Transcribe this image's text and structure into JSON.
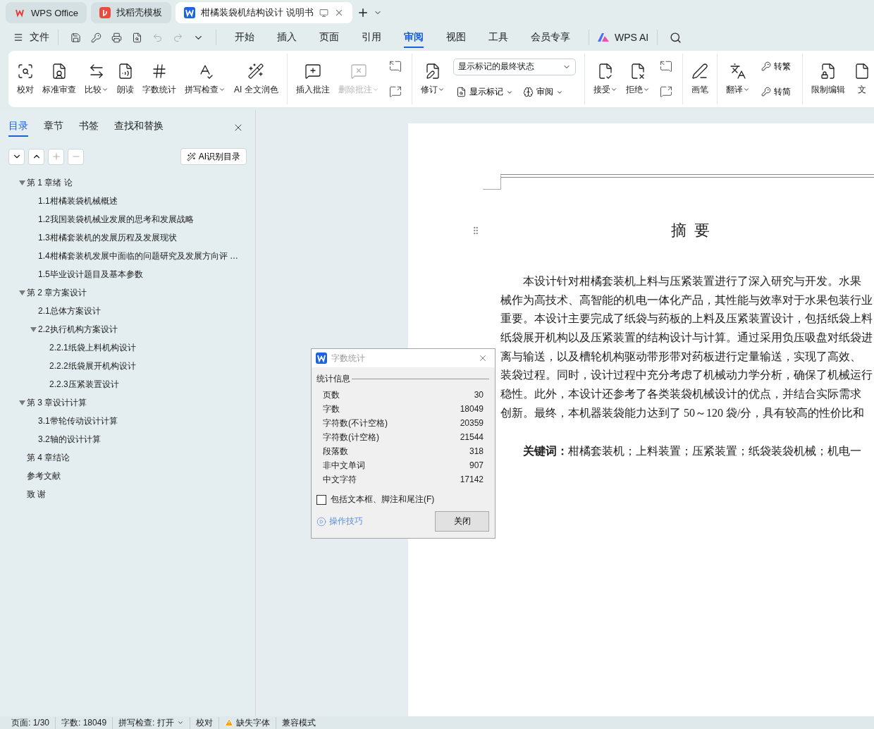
{
  "tabs": [
    {
      "label": "WPS Office",
      "kind": "home",
      "selected": false
    },
    {
      "label": "找稻壳模板",
      "kind": "template",
      "selected": false
    },
    {
      "label": "柑橘装袋机结构设计 说明书",
      "kind": "doc",
      "selected": true
    }
  ],
  "menu": {
    "file": "文件",
    "tabs": [
      {
        "label": "开始",
        "selected": false
      },
      {
        "label": "插入",
        "selected": false
      },
      {
        "label": "页面",
        "selected": false
      },
      {
        "label": "引用",
        "selected": false
      },
      {
        "label": "审阅",
        "selected": true
      },
      {
        "label": "视图",
        "selected": false
      },
      {
        "label": "工具",
        "selected": false
      },
      {
        "label": "会员专享",
        "selected": false
      }
    ],
    "ai": "WPS AI"
  },
  "ribbon": [
    {
      "items": [
        {
          "kind": "big",
          "label": "校对",
          "caret": false,
          "disabled": false
        },
        {
          "kind": "big",
          "label": "标准审查",
          "caret": false,
          "disabled": false
        },
        {
          "kind": "big",
          "label": "比较",
          "caret": true,
          "disabled": false
        },
        {
          "kind": "big",
          "label": "朗读",
          "caret": false,
          "disabled": false
        },
        {
          "kind": "big",
          "label": "字数统计",
          "caret": false,
          "disabled": false
        },
        {
          "kind": "big",
          "label": "拼写检查",
          "caret": true,
          "disabled": false
        },
        {
          "kind": "big",
          "label": "AI 全文润色",
          "caret": false,
          "disabled": false
        }
      ]
    },
    {
      "items": [
        {
          "kind": "big",
          "label": "插入批注",
          "caret": false,
          "disabled": false
        },
        {
          "kind": "big",
          "label": "删除批注",
          "caret": true,
          "disabled": true
        },
        {
          "kind": "icons"
        }
      ]
    },
    {
      "items": [
        {
          "kind": "big",
          "label": "修订",
          "caret": true,
          "disabled": false
        },
        {
          "kind": "panel",
          "select": "显示标记的最终状态",
          "buttons": [
            {
              "label": "显示标记"
            },
            {
              "label": "审阅"
            }
          ]
        }
      ]
    },
    {
      "items": [
        {
          "kind": "big",
          "label": "接受",
          "caret": true,
          "disabled": false
        },
        {
          "kind": "big",
          "label": "拒绝",
          "caret": true,
          "disabled": false
        },
        {
          "kind": "icons"
        }
      ]
    },
    {
      "items": [
        {
          "kind": "big",
          "label": "画笔",
          "caret": false,
          "disabled": false
        }
      ]
    },
    {
      "items": [
        {
          "kind": "big",
          "label": "翻译",
          "caret": true,
          "disabled": false
        },
        {
          "kind": "stack",
          "buttons": [
            {
              "label": "转繁"
            },
            {
              "label": "转简"
            }
          ]
        }
      ]
    },
    {
      "items": [
        {
          "kind": "big",
          "label": "限制编辑",
          "caret": false,
          "disabled": false
        },
        {
          "kind": "big",
          "label": "文",
          "caret": false,
          "disabled": false
        }
      ]
    }
  ],
  "sidebar": {
    "tabs": [
      {
        "label": "目录",
        "selected": true
      },
      {
        "label": "章节",
        "selected": false
      },
      {
        "label": "书签",
        "selected": false
      },
      {
        "label": "查找和替换",
        "selected": false
      }
    ],
    "toolbar": [
      {
        "kind": "down",
        "disabled": false
      },
      {
        "kind": "up",
        "disabled": false
      },
      {
        "kind": "plus",
        "disabled": true
      },
      {
        "kind": "minus",
        "disabled": true
      }
    ],
    "ai_button": "AI识别目录",
    "toc": [
      {
        "label": "第 1 章绪  论",
        "expanded": true,
        "children": [
          {
            "label": "1.1柑橘装袋机械概述"
          },
          {
            "label": "1.2我国装袋机械业发展的思考和发展战略"
          },
          {
            "label": "1.3柑橘套装机的发展历程及发展现状"
          },
          {
            "label": "1.4柑橘套装机发展中面临的问题研究及发展方向评 …"
          },
          {
            "label": "1.5毕业设计题目及基本参数"
          }
        ]
      },
      {
        "label": "第 2 章方案设计",
        "expanded": true,
        "children": [
          {
            "label": "2.1总体方案设计"
          },
          {
            "label": "2.2执行机构方案设计",
            "expanded": true,
            "children": [
              {
                "label": "2.2.1纸袋上料机构设计"
              },
              {
                "label": "2.2.2纸袋展开机构设计"
              },
              {
                "label": "2.2.3压紧装置设计"
              }
            ]
          }
        ]
      },
      {
        "label": "第 3 章设计计算",
        "expanded": true,
        "children": [
          {
            "label": "3.1带轮传动设计计算"
          },
          {
            "label": "3.2轴的设计计算"
          }
        ]
      },
      {
        "label": "第 4 章结论"
      },
      {
        "label": "参考文献"
      },
      {
        "label": "致  谢"
      }
    ]
  },
  "document": {
    "title": "摘  要",
    "lines": [
      "本设计针对柑橘套装机上料与压紧装置进行了深入研究与开发。水果",
      "械作为高技术、高智能的机电一体化产品，其性能与效率对于水果包装行业",
      "重要。本设计主要完成了纸袋与药板的上料及压紧装置设计，包括纸袋上料",
      "纸袋展开机构以及压紧装置的结构设计与计算。通过采用负压吸盘对纸袋进",
      "离与输送，以及槽轮机构驱动带形带对药板进行定量输送，实现了高效、",
      "装袋过程。同时，设计过程中充分考虑了机械动力学分析，确保了机械运行",
      "稳性。此外，本设计还参考了各类装袋机械设计的优点，并结合实际需求",
      "创新。最终，本机器装袋能力达到了 50～120 袋/分，具有较高的性价比和"
    ],
    "keywords": "**关键词：**柑橘套装机；上料装置；压紧装置；纸袋装袋机械；机电一"
  },
  "dialog": {
    "title": "字数统计",
    "section": "统计信息",
    "stats": [
      {
        "label": "页数",
        "value": "30"
      },
      {
        "label": "字数",
        "value": "18049"
      },
      {
        "label": "字符数(不计空格)",
        "value": "20359"
      },
      {
        "label": "字符数(计空格)",
        "value": "21544"
      },
      {
        "label": "段落数",
        "value": "318"
      },
      {
        "label": "非中文单词",
        "value": "907"
      },
      {
        "label": "中文字符",
        "value": "17142"
      }
    ],
    "checkbox": {
      "label": "包括文本框、脚注和尾注(F)",
      "checked": false
    },
    "tips": "操作技巧",
    "close": "关闭"
  },
  "status_bar": [
    {
      "text": "页面: 1/30",
      "kind": "text"
    },
    {
      "text": "字数: 18049",
      "kind": "text"
    },
    {
      "text": "拼写检查: 打开",
      "kind": "dropdown"
    },
    {
      "text": "校对",
      "kind": "text"
    },
    {
      "text": "缺失字体",
      "kind": "warning"
    },
    {
      "text": "兼容模式",
      "kind": "text"
    }
  ]
}
